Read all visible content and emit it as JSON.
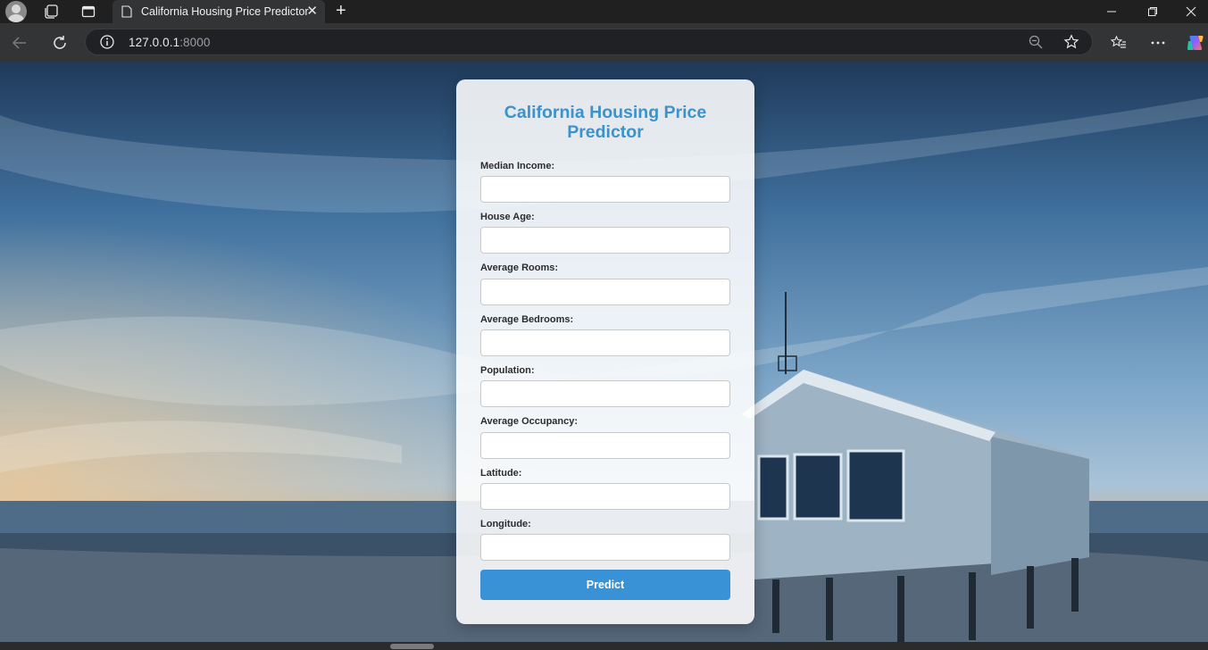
{
  "browser": {
    "tab_title": "California Housing Price Predictor",
    "tab_close_glyph": "✕",
    "new_tab_glyph": "+",
    "url_host": "127.0.0.1",
    "url_port": ":8000",
    "window_controls": {
      "minimize": "—",
      "restore": "❐",
      "close": "✕"
    },
    "icons": [
      "profile-avatar-icon",
      "workspaces-icon",
      "vertical-tabs-icon",
      "page-icon",
      "back-icon",
      "refresh-icon",
      "site-info-icon",
      "zoom-out-icon",
      "favorite-star-icon",
      "favorites-list-icon",
      "more-options-icon",
      "copilot-icon"
    ]
  },
  "form": {
    "title": "California Housing Price Predictor",
    "fields": [
      {
        "label": "Median Income:",
        "value": ""
      },
      {
        "label": "House Age:",
        "value": ""
      },
      {
        "label": "Average Rooms:",
        "value": ""
      },
      {
        "label": "Average Bedrooms:",
        "value": ""
      },
      {
        "label": "Population:",
        "value": ""
      },
      {
        "label": "Average Occupancy:",
        "value": ""
      },
      {
        "label": "Latitude:",
        "value": ""
      },
      {
        "label": "Longitude:",
        "value": ""
      }
    ],
    "submit_label": "Predict"
  },
  "colors": {
    "title": "#3d93c9",
    "button": "#3a92d6"
  }
}
